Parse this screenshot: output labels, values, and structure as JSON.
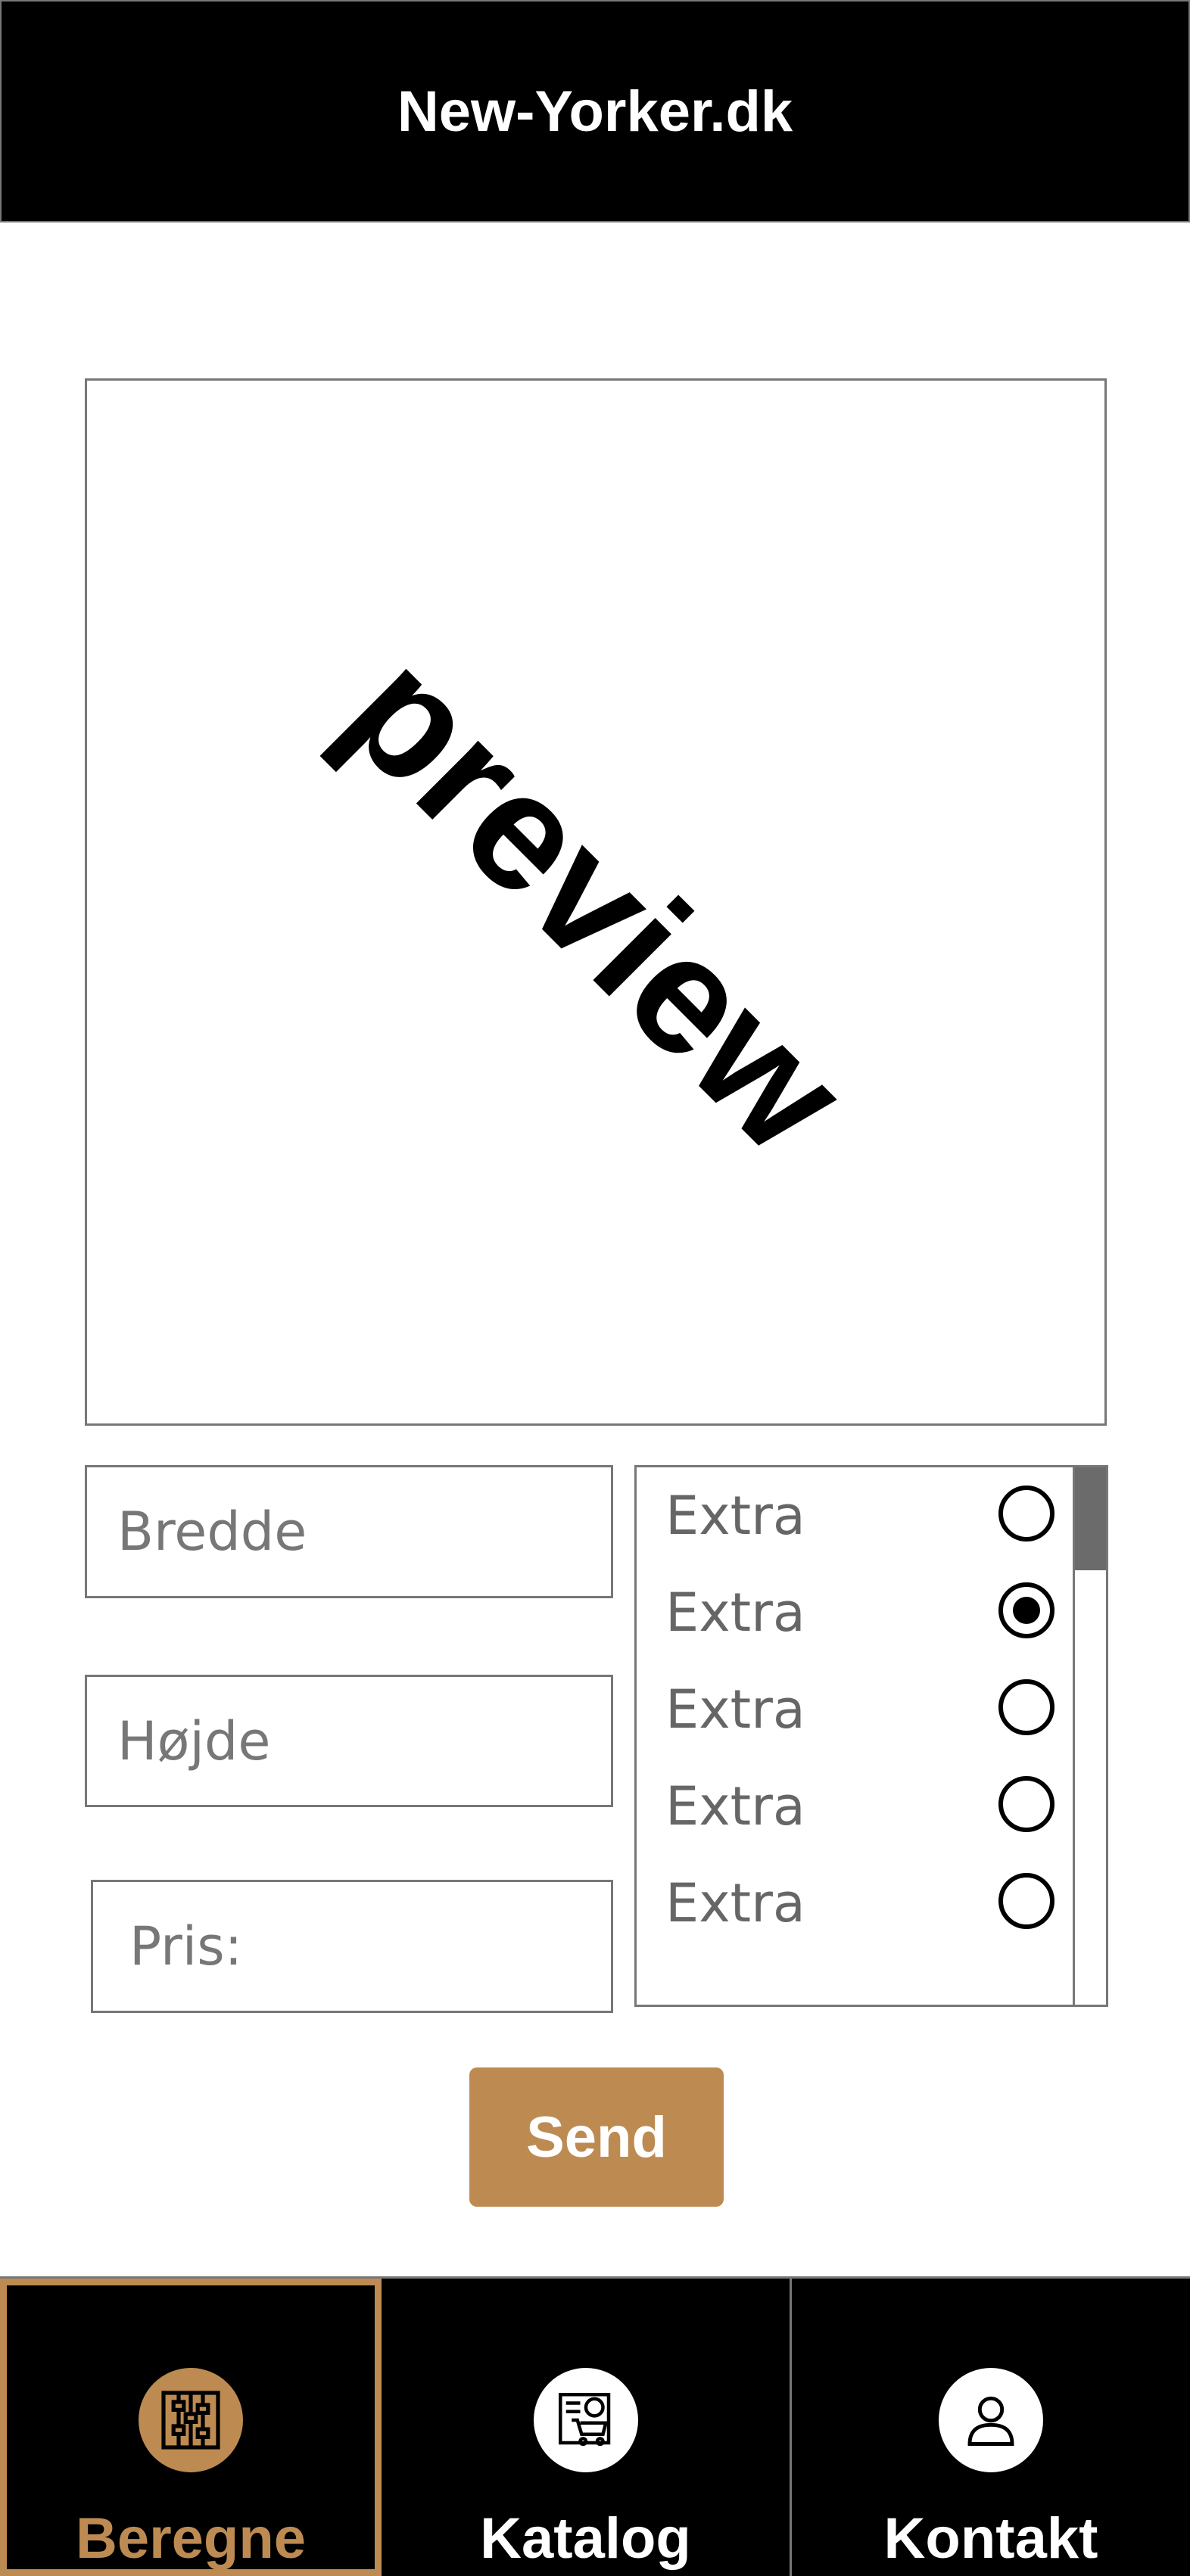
{
  "header": {
    "title": "New-Yorker.dk"
  },
  "preview": {
    "text": "preview"
  },
  "form": {
    "width_placeholder": "Bredde",
    "height_placeholder": "Højde",
    "price_placeholder": "Pris:",
    "extras": [
      {
        "label": "Extra",
        "checked": false
      },
      {
        "label": "Extra",
        "checked": true
      },
      {
        "label": "Extra",
        "checked": false
      },
      {
        "label": "Extra",
        "checked": false
      },
      {
        "label": "Extra",
        "checked": false
      }
    ],
    "send_label": "Send"
  },
  "nav": {
    "items": [
      {
        "label": "Beregne",
        "icon": "abacus-icon",
        "active": true
      },
      {
        "label": "Katalog",
        "icon": "catalog-cart-icon",
        "active": false
      },
      {
        "label": "Kontakt",
        "icon": "user-icon",
        "active": false
      }
    ]
  },
  "colors": {
    "accent": "#bd8b52",
    "bar": "#000000",
    "border": "#777777"
  }
}
